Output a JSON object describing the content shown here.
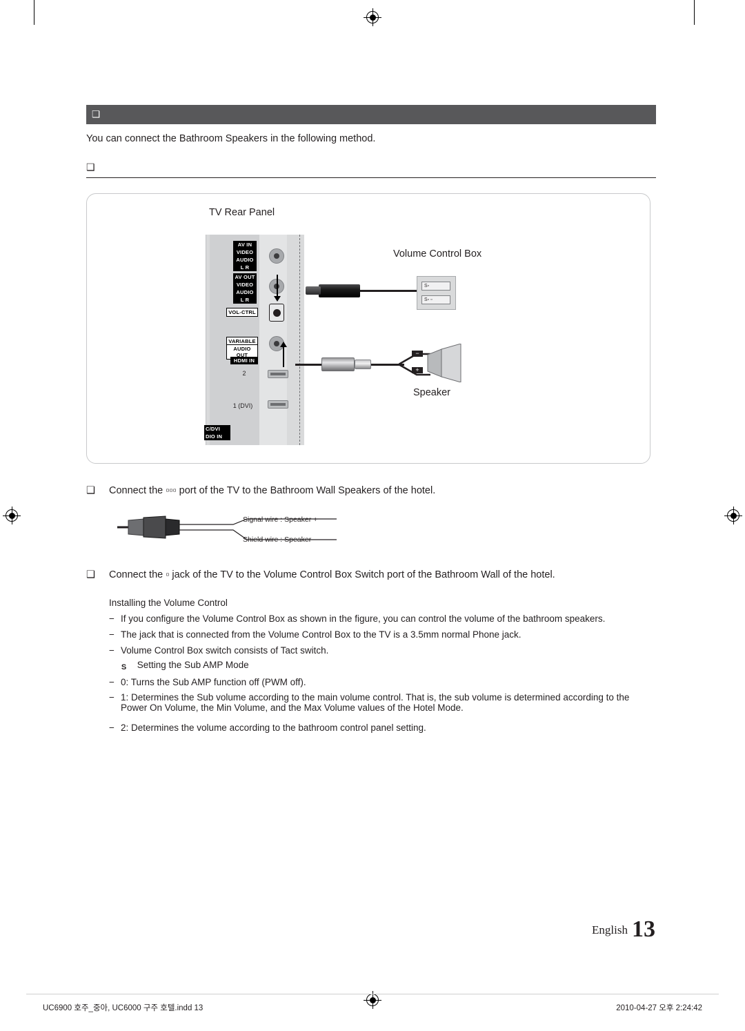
{
  "document": {
    "section_title": "❑",
    "intro": "You can connect the Bathroom Speakers in the following method.",
    "sub_head": "❑",
    "figure": {
      "label_tv_rear": "TV Rear Panel",
      "label_volume_control_box": "Volume Control Box",
      "label_speaker": "Speaker",
      "panel_jacks": [
        {
          "id": "av-in",
          "label": "AV IN"
        },
        {
          "id": "video-in",
          "label": "VIDEO"
        },
        {
          "id": "audio-in",
          "label": "AUDIO"
        },
        {
          "id": "audio-in-lr",
          "label": "L  R"
        },
        {
          "id": "av-out",
          "label": "AV OUT"
        },
        {
          "id": "video-out",
          "label": "VIDEO"
        },
        {
          "id": "audio-out",
          "label": "AUDIO"
        },
        {
          "id": "audio-out-lr",
          "label": "L  R"
        },
        {
          "id": "vol-ctrl",
          "label": "VOL-CTRL"
        },
        {
          "id": "variable",
          "label": "VARIABLE"
        },
        {
          "id": "variable-audio-out",
          "label": "AUDIO OUT"
        },
        {
          "id": "hdmi-in",
          "label": "HDMI IN"
        },
        {
          "id": "hdmi-2",
          "label": "2"
        },
        {
          "id": "hdmi-1-dvi",
          "label": "1 (DVI)"
        },
        {
          "id": "pc-dvi",
          "label": "C/DVI"
        },
        {
          "id": "audio-in-bottom",
          "label": "DIO IN"
        }
      ],
      "vcb_slots": [
        {
          "id": "slot-1",
          "label": "S▫"
        },
        {
          "id": "slot-2",
          "label": "S▫  ▫"
        }
      ]
    },
    "bullets": [
      {
        "marker": "❑",
        "text": "Connect the ▫▫▫ port of the TV to the Bathroom Wall Speakers of the hotel."
      },
      {
        "marker": "❑",
        "text": "Connect the ▫ jack of the TV to the Volume Control Box Switch port of the Bathroom Wall of the hotel."
      }
    ],
    "wire_notes": [
      "Signal wire : Speaker +",
      "Shield wire : Speaker -"
    ],
    "install_title": "Installing the Volume Control",
    "install_items": [
      {
        "dash": "−",
        "text": "If you configure the Volume Control Box as shown in the figure, you can control the volume of the bathroom speakers."
      },
      {
        "dash": "−",
        "text": "The jack that is connected from the Volume Control Box to the TV is a 3.5mm normal Phone jack."
      },
      {
        "dash": "−",
        "text": "Volume Control Box switch consists of Tact switch."
      }
    ],
    "sub_amp": {
      "badge": "S",
      "title": "Setting the Sub AMP Mode",
      "items": [
        {
          "dash": "−",
          "text": "0: Turns the Sub AMP function off (PWM off)."
        },
        {
          "dash": "−",
          "text": "1: Determines the Sub volume according to the main volume control. That is, the sub volume is determined according to the Power On Volume, the Min Volume, and the Max Volume values of the Hotel Mode."
        },
        {
          "dash": "−",
          "text": "2: Determines the volume according to the bathroom control panel setting."
        }
      ]
    },
    "footer": {
      "language": "English",
      "page_number": "13"
    },
    "print_footer": {
      "file": "UC6900 호주_중아, UC6000 구주 호텔.indd   13",
      "timestamp": "2010-04-27   오후 2:24:42"
    }
  }
}
